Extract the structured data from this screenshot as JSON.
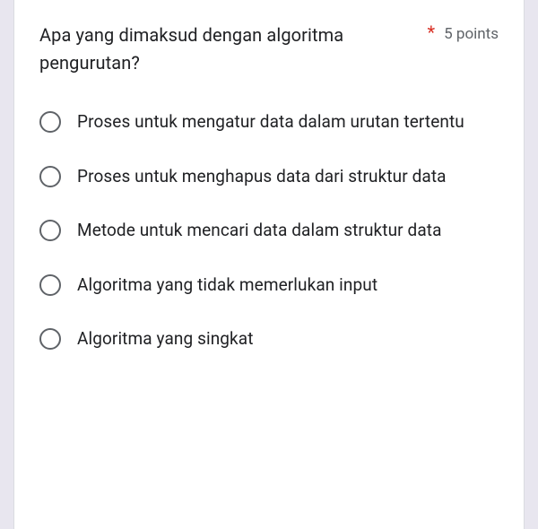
{
  "question": {
    "text": "Apa yang dimaksud dengan algoritma pengurutan?",
    "required_mark": "*",
    "points": "5 points"
  },
  "options": [
    {
      "label": "Proses untuk mengatur data dalam urutan tertentu"
    },
    {
      "label": "Proses untuk menghapus data dari struktur data"
    },
    {
      "label": "Metode untuk mencari data dalam struktur data"
    },
    {
      "label": "Algoritma yang tidak memerlukan input"
    },
    {
      "label": "Algoritma yang singkat"
    }
  ]
}
